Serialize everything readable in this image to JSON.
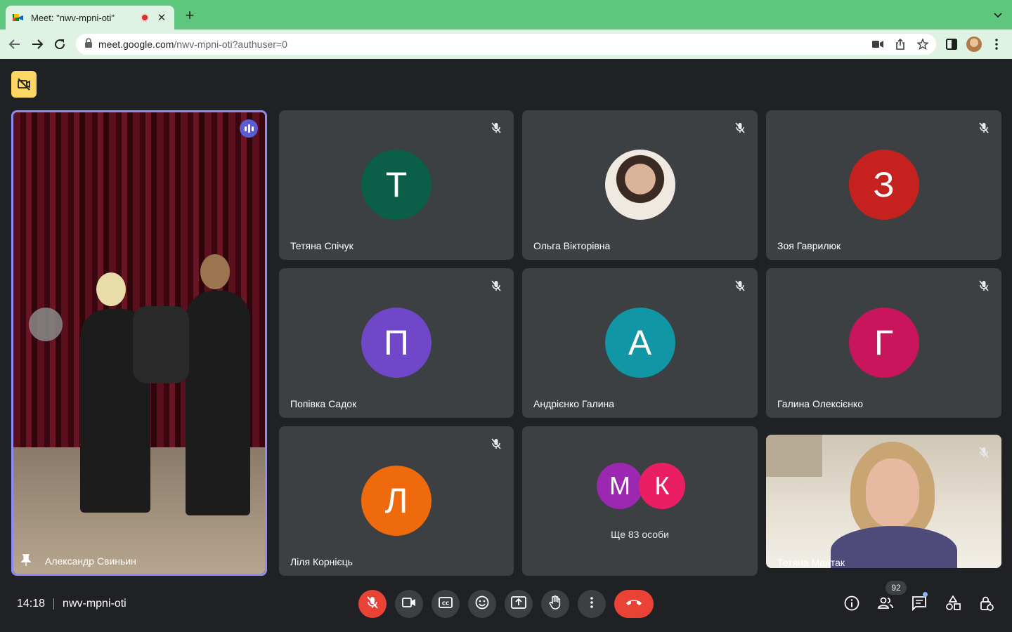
{
  "browser": {
    "tab_title": "Meet: \"nwv-mpni-oti\"",
    "new_tab_label": "+",
    "url_host": "meet.google.com",
    "url_path": "/nwv-mpni-oti?authuser=0"
  },
  "meeting": {
    "time": "14:18",
    "code": "nwv-mpni-oti",
    "participant_count": "92"
  },
  "pinned": {
    "name": "Александр Свиньин"
  },
  "tiles": [
    {
      "name": "Тетяна Спічук",
      "initial": "Т",
      "color": "#0b5e47"
    },
    {
      "name": "Ольга Вікторівна",
      "initial": "",
      "color": "#c9a08a"
    },
    {
      "name": "Зоя Гаврилюк",
      "initial": "З",
      "color": "#c5221f"
    },
    {
      "name": "Попівка Садок",
      "initial": "П",
      "color": "#6f47c8"
    },
    {
      "name": "Андрієнко Галина",
      "initial": "А",
      "color": "#1196a6"
    },
    {
      "name": "Галина Олексієнко",
      "initial": "Г",
      "color": "#c8155b"
    },
    {
      "name": "Ліля Корнієць",
      "initial": "Л",
      "color": "#ee6a0c"
    },
    {
      "name": "Тетяна Мантак",
      "initial": "",
      "color": ""
    }
  ],
  "more": {
    "bubbles": [
      {
        "initial": "М",
        "color": "#9c27b0"
      },
      {
        "initial": "К",
        "color": "#e91e63"
      }
    ],
    "text": "Ще 83 особи"
  },
  "icons": {
    "mic": "mic-off-icon",
    "camera": "videocam-icon",
    "captions": "closed-caption-icon",
    "emoji": "emoji-icon",
    "present": "present-screen-icon",
    "hand": "raise-hand-icon",
    "more": "more-vert-icon",
    "end": "call-end-icon",
    "info": "info-icon",
    "people": "people-icon",
    "chat": "chat-icon",
    "activities": "activities-icon",
    "host": "host-controls-icon"
  }
}
